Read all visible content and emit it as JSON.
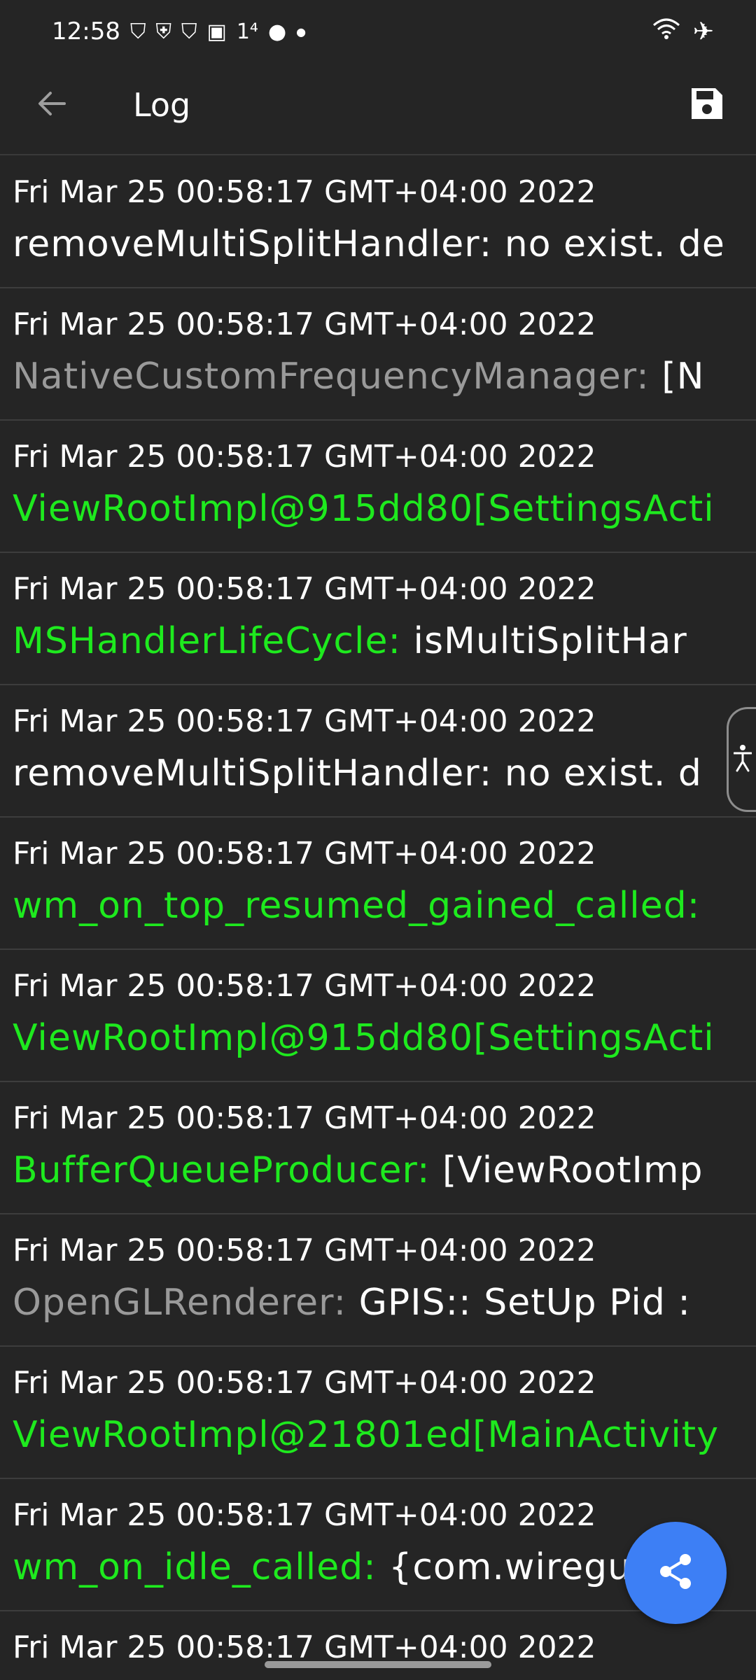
{
  "status_bar": {
    "time": "12:58",
    "icons": [
      "shield-wifi-icon",
      "shield-check-icon",
      "shield-wifi-icon",
      "image-icon",
      "notification-count",
      "fruit-icon",
      "dot-icon"
    ],
    "notification_count": "1⁴",
    "right_icons": [
      "wifi-icon",
      "airplane-icon"
    ]
  },
  "app_bar": {
    "title": "Log",
    "back_icon": "arrow-left-icon",
    "save_icon": "floppy-disk-icon"
  },
  "log_entries": [
    {
      "date": "Fri Mar 25 00:58:17 GMT+04:00 2022",
      "tag": "",
      "message": "removeMultiSplitHandler: no exist. de",
      "tag_color": "white"
    },
    {
      "date": "Fri Mar 25 00:58:17 GMT+04:00 2022",
      "tag": "NativeCustomFrequencyManager:",
      "message": " [N",
      "tag_color": "gray"
    },
    {
      "date": "Fri Mar 25 00:58:17 GMT+04:00 2022",
      "tag": "ViewRootImpl@915dd80[SettingsActi",
      "message": "",
      "tag_color": "green"
    },
    {
      "date": "Fri Mar 25 00:58:17 GMT+04:00 2022",
      "tag": "MSHandlerLifeCycle:",
      "message": " isMultiSplitHar",
      "tag_color": "green"
    },
    {
      "date": "Fri Mar 25 00:58:17 GMT+04:00 2022",
      "tag": "",
      "message": "removeMultiSplitHandler: no exist. d",
      "tag_color": "white"
    },
    {
      "date": "Fri Mar 25 00:58:17 GMT+04:00 2022",
      "tag": "wm_on_top_resumed_gained_called:",
      "message": "",
      "tag_color": "green"
    },
    {
      "date": "Fri Mar 25 00:58:17 GMT+04:00 2022",
      "tag": "ViewRootImpl@915dd80[SettingsActi",
      "message": "",
      "tag_color": "green"
    },
    {
      "date": "Fri Mar 25 00:58:17 GMT+04:00 2022",
      "tag": "BufferQueueProducer:",
      "message": " [ViewRootImp",
      "tag_color": "green"
    },
    {
      "date": "Fri Mar 25 00:58:17 GMT+04:00 2022",
      "tag": "OpenGLRenderer:",
      "message": " GPIS:: SetUp Pid :",
      "tag_color": "gray"
    },
    {
      "date": "Fri Mar 25 00:58:17 GMT+04:00 2022",
      "tag": "ViewRootImpl@21801ed[MainActivity",
      "message": "",
      "tag_color": "green"
    },
    {
      "date": "Fri Mar 25 00:58:17 GMT+04:00 2022",
      "tag": "wm_on_idle_called:",
      "message": " {com.wireguard.a",
      "tag_color": "green"
    },
    {
      "date": "Fri Mar 25 00:58:17 GMT+04:00 2022",
      "tag": "",
      "message": "",
      "tag_color": "white"
    }
  ],
  "side_tab_icon": "accessibility-icon",
  "fab": {
    "icon": "share-icon"
  },
  "colors": {
    "background": "#252525",
    "tag_green": "#1eea1e",
    "tag_gray": "#9a9a9a",
    "fab": "#3d7ff5"
  }
}
